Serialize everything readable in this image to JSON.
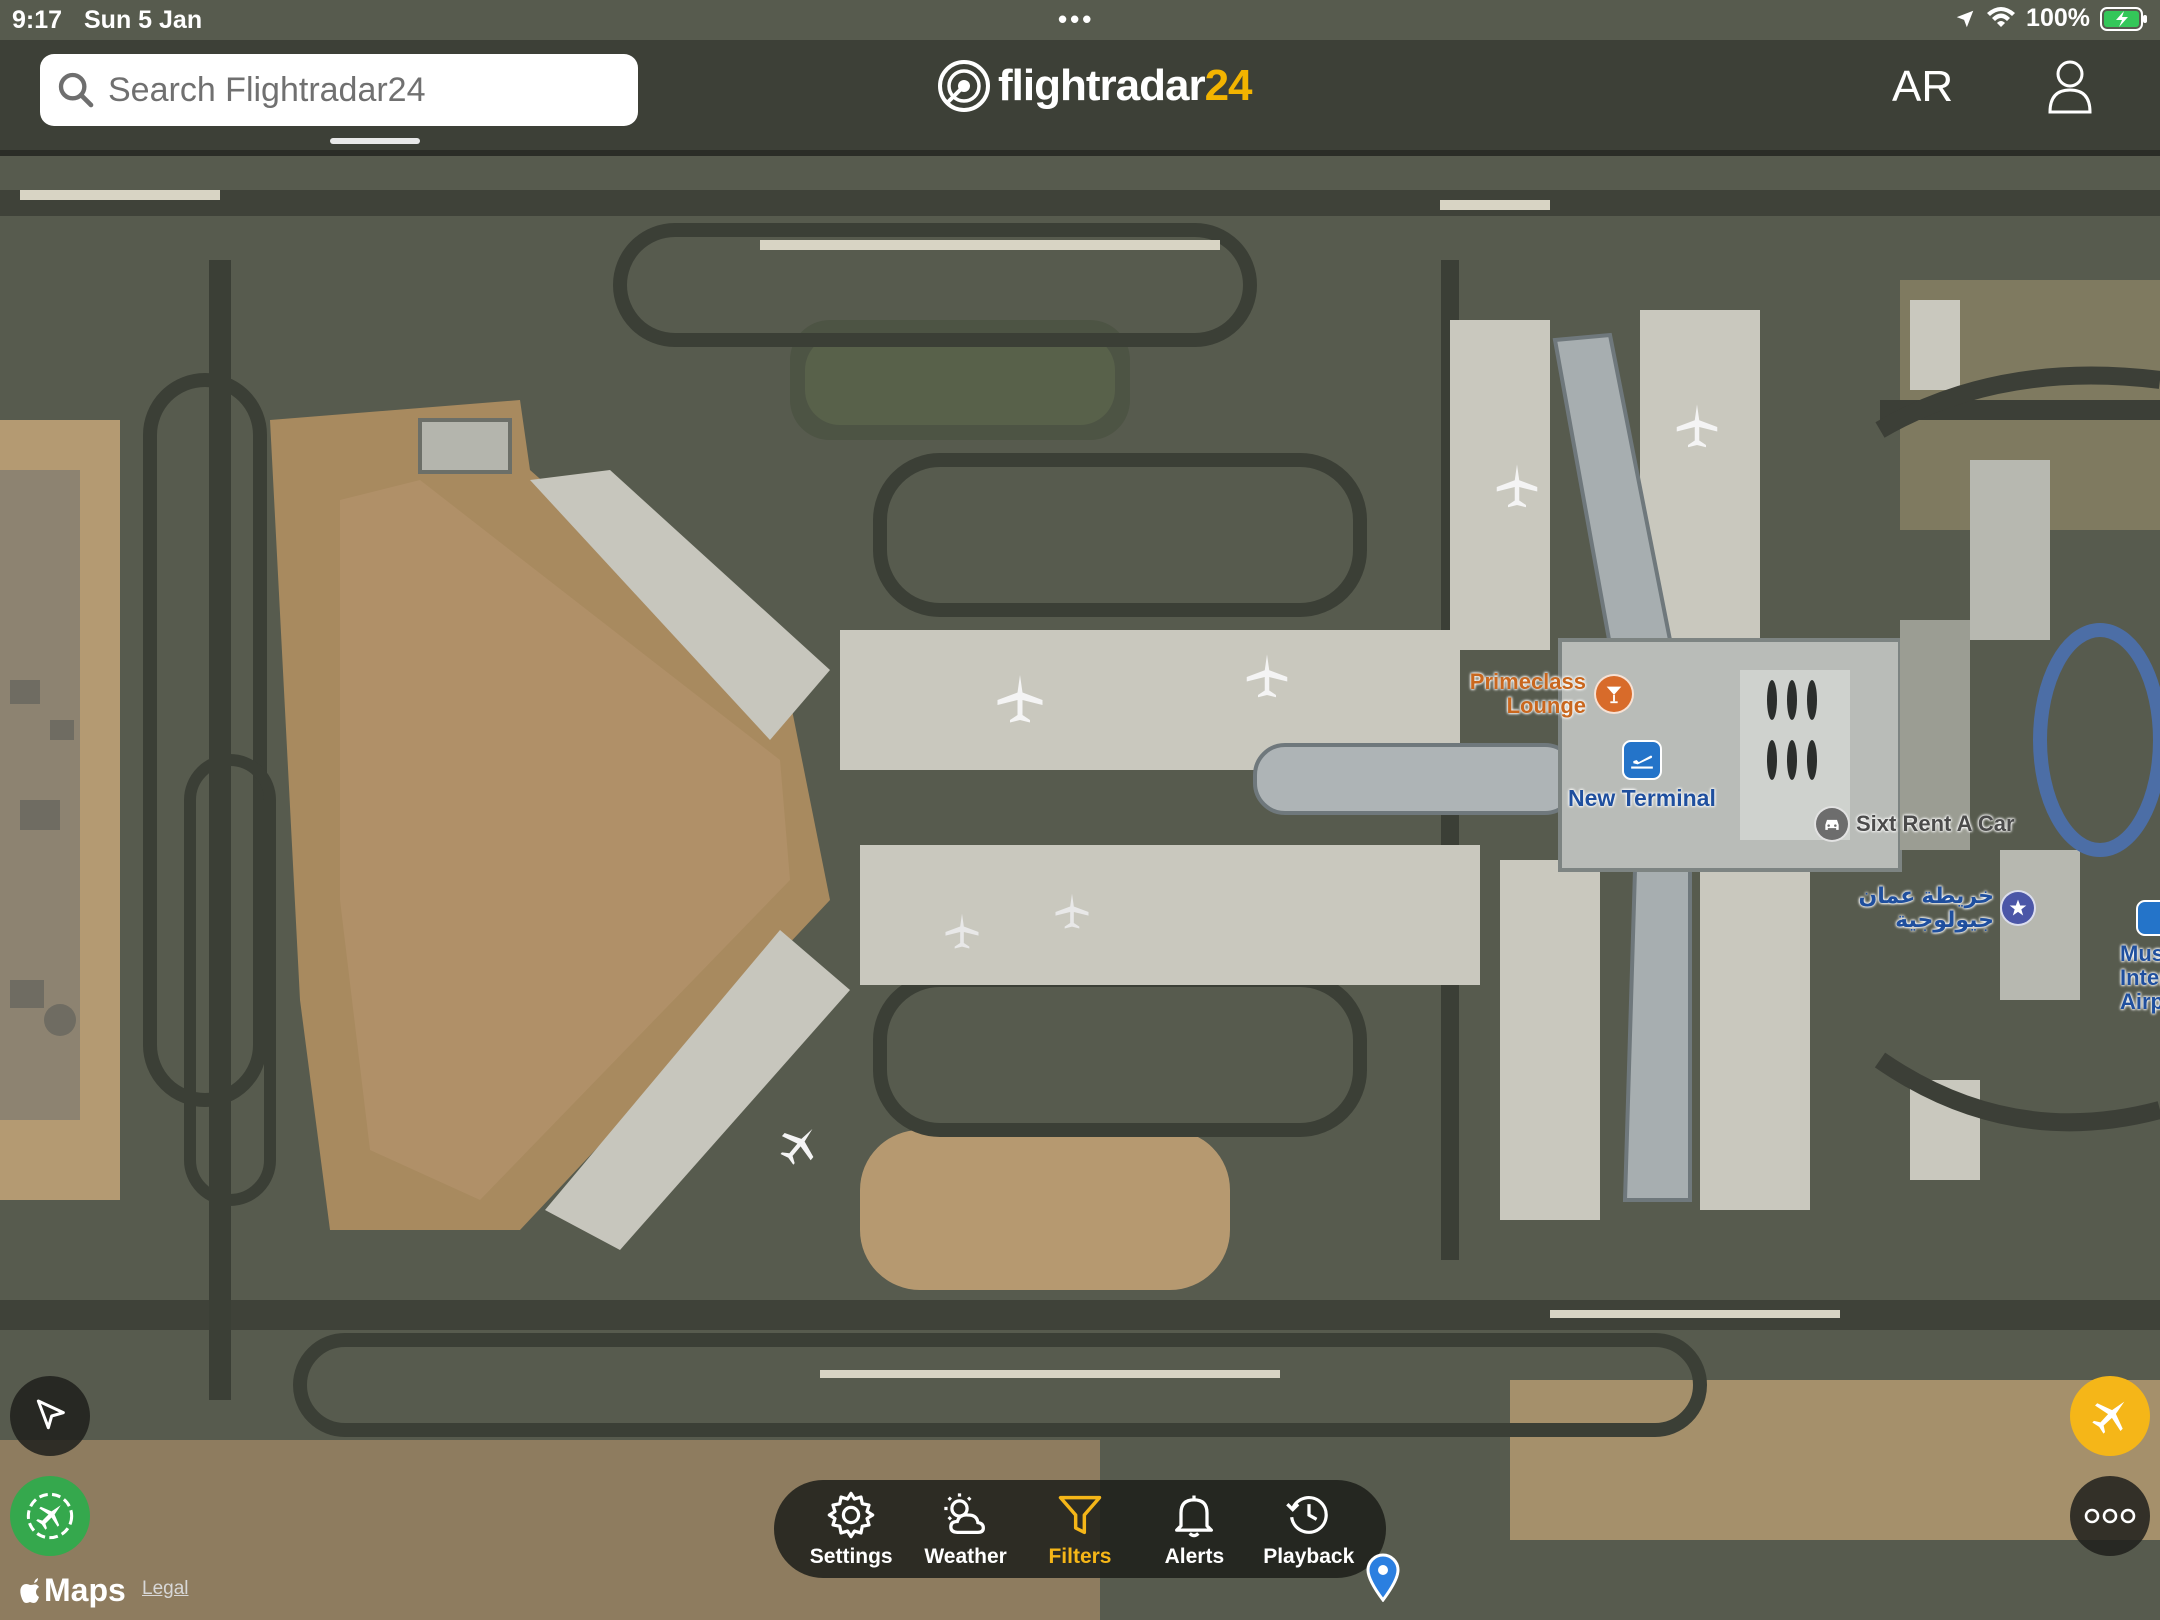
{
  "status_bar": {
    "time": "9:17",
    "date": "Sun 5 Jan",
    "battery": "100%"
  },
  "header": {
    "search_placeholder": "Search Flightradar24",
    "logo_main": "flightradar",
    "logo_accent": "24",
    "ar_label": "AR"
  },
  "map_labels": {
    "lounge": "Primeclass Lounge",
    "terminal": "New Terminal",
    "car_rental": "Sixt Rent A Car",
    "arabic_poi": "خريطة عمان جيولوجية",
    "airport_partial_1": "Mus",
    "airport_partial_2": "Interna",
    "airport_partial_3": "Airport"
  },
  "toolbar": {
    "items": [
      {
        "label": "Settings",
        "icon": "gear-icon"
      },
      {
        "label": "Weather",
        "icon": "weather-icon"
      },
      {
        "label": "Filters",
        "icon": "filter-icon",
        "active": true
      },
      {
        "label": "Alerts",
        "icon": "bell-icon"
      },
      {
        "label": "Playback",
        "icon": "history-icon"
      }
    ]
  },
  "footer": {
    "maps_brand": "Maps",
    "legal": "Legal"
  },
  "colors": {
    "accent": "#f5b618",
    "green": "#35a84d",
    "lounge_label": "#c9671e",
    "terminal_label": "#1f4f9e"
  }
}
